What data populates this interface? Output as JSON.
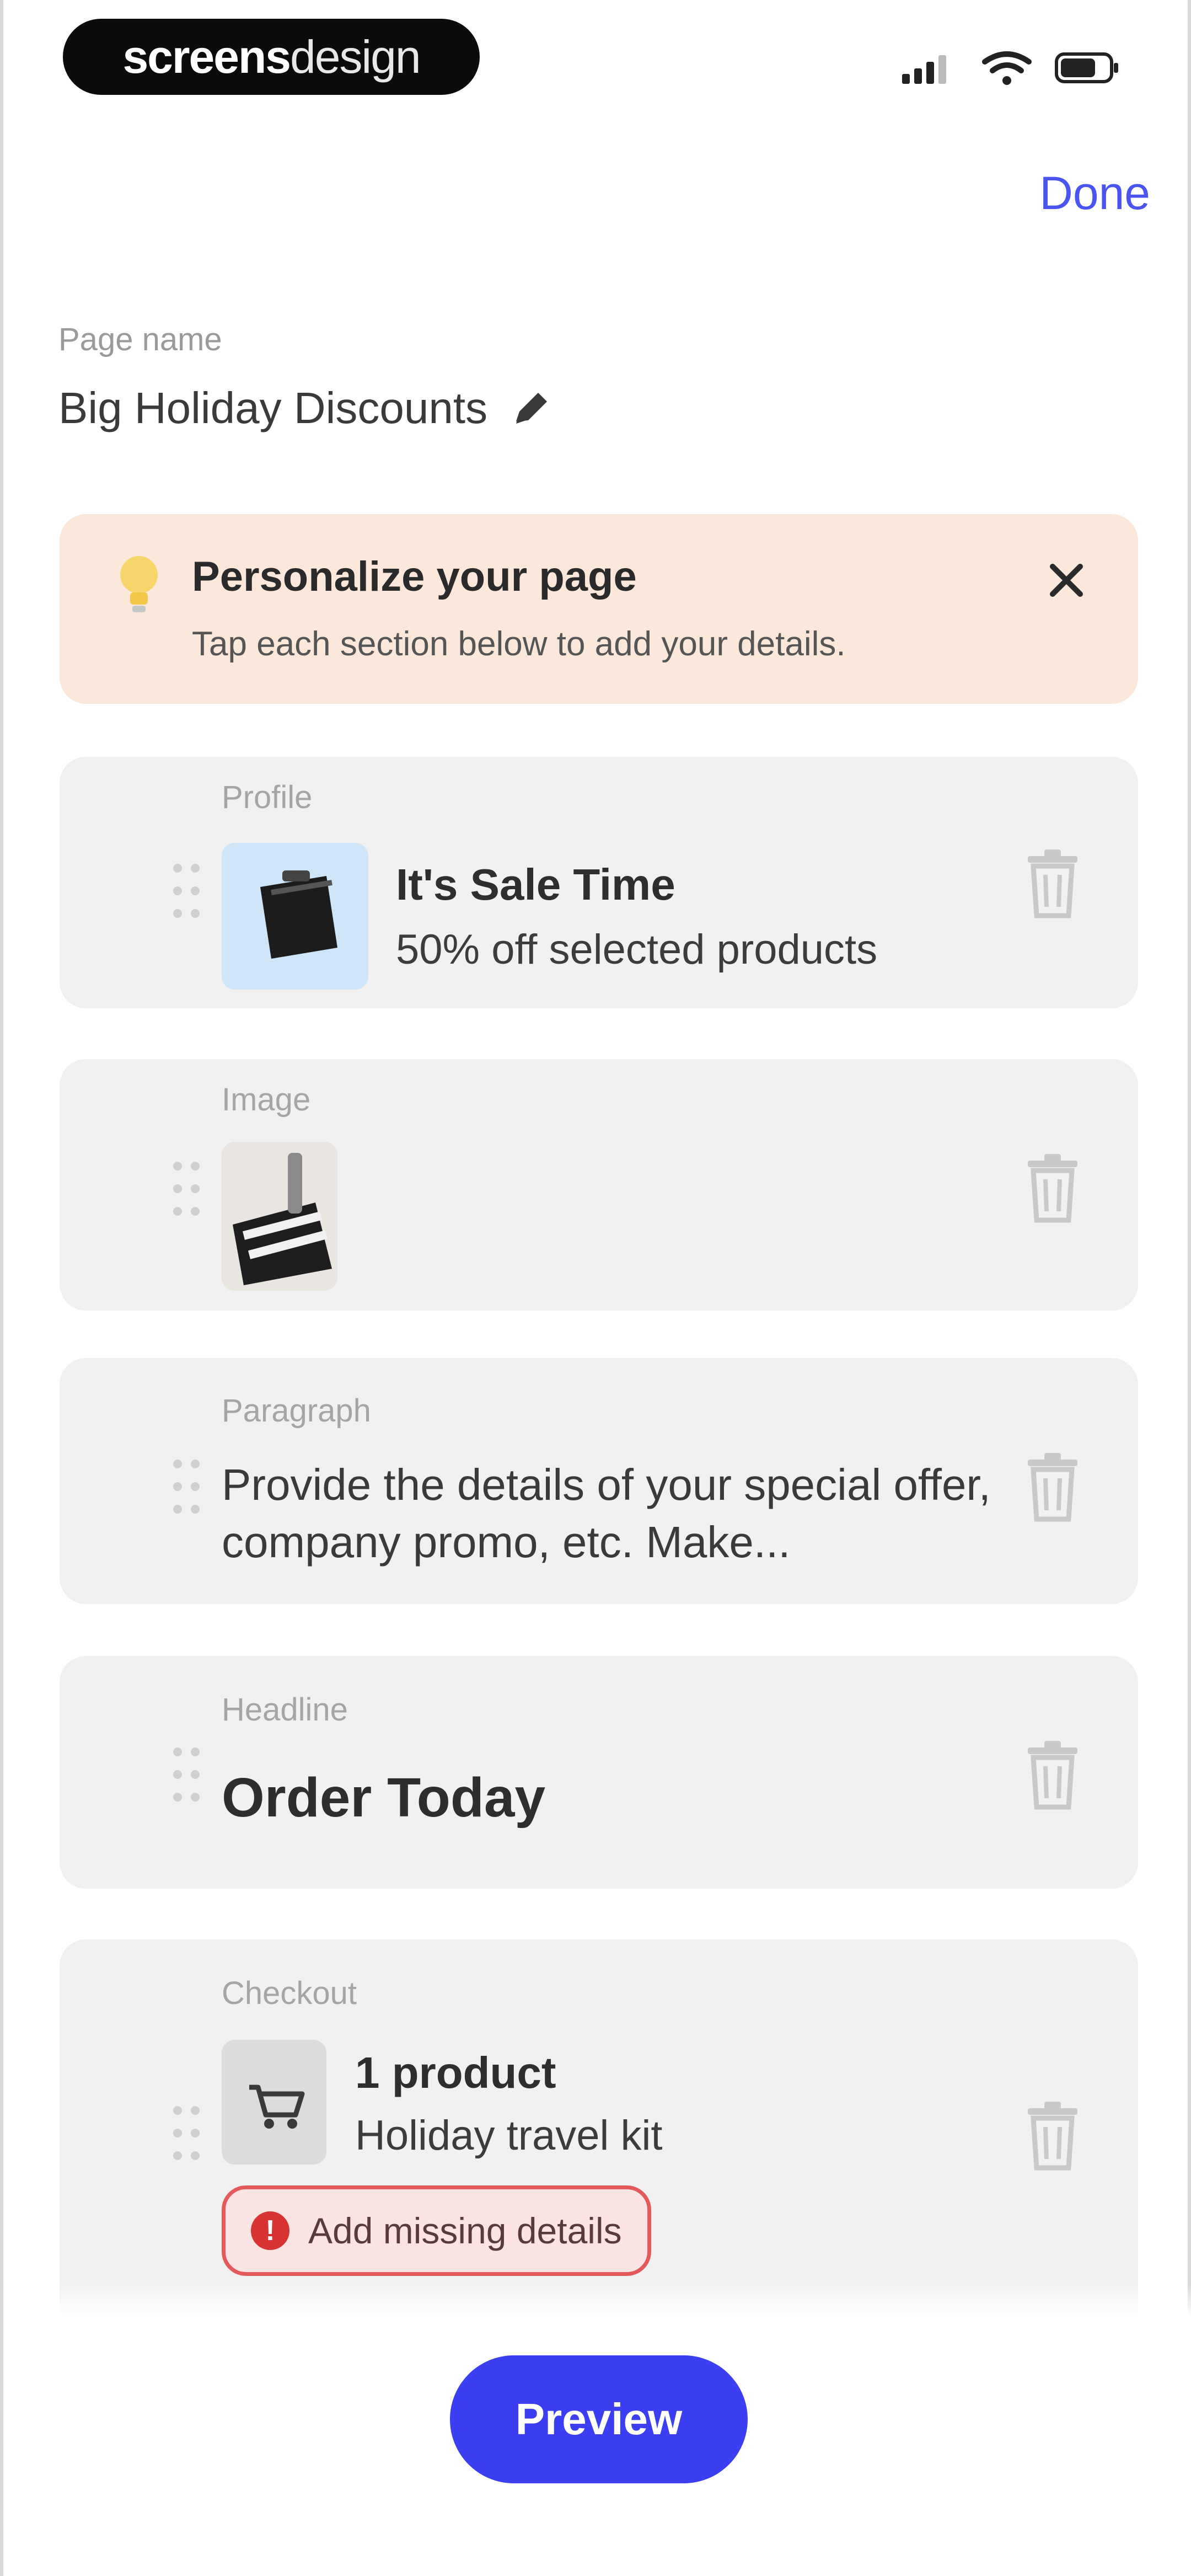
{
  "status_bar": {
    "brand_part1": "screens",
    "brand_part2": "design",
    "icons": [
      "signal-icon",
      "wifi-icon",
      "battery-icon"
    ]
  },
  "header": {
    "done_label": "Done"
  },
  "page_name": {
    "label": "Page name",
    "value": "Big Holiday Discounts",
    "edit_icon": "pencil-icon"
  },
  "tip": {
    "title": "Personalize your page",
    "subtitle": "Tap each section below to add your details.",
    "icon": "lightbulb-icon",
    "close_icon": "close-icon"
  },
  "sections": {
    "profile": {
      "label": "Profile",
      "title": "It's Sale Time",
      "subtitle": "50% off selected products"
    },
    "image": {
      "label": "Image"
    },
    "paragraph": {
      "label": "Paragraph",
      "text": "Provide the details of your special offer, company promo, etc. Make..."
    },
    "headline": {
      "label": "Headline",
      "text": "Order Today"
    },
    "checkout": {
      "label": "Checkout",
      "title": "1 product",
      "subtitle": "Holiday travel kit",
      "warning": "Add missing details"
    }
  },
  "footer": {
    "preview_label": "Preview"
  },
  "colors": {
    "accent": "#3c3ef2",
    "tip_bg": "#fbe8da",
    "card_bg": "#f1f1f1",
    "error": "#e45a5a"
  }
}
